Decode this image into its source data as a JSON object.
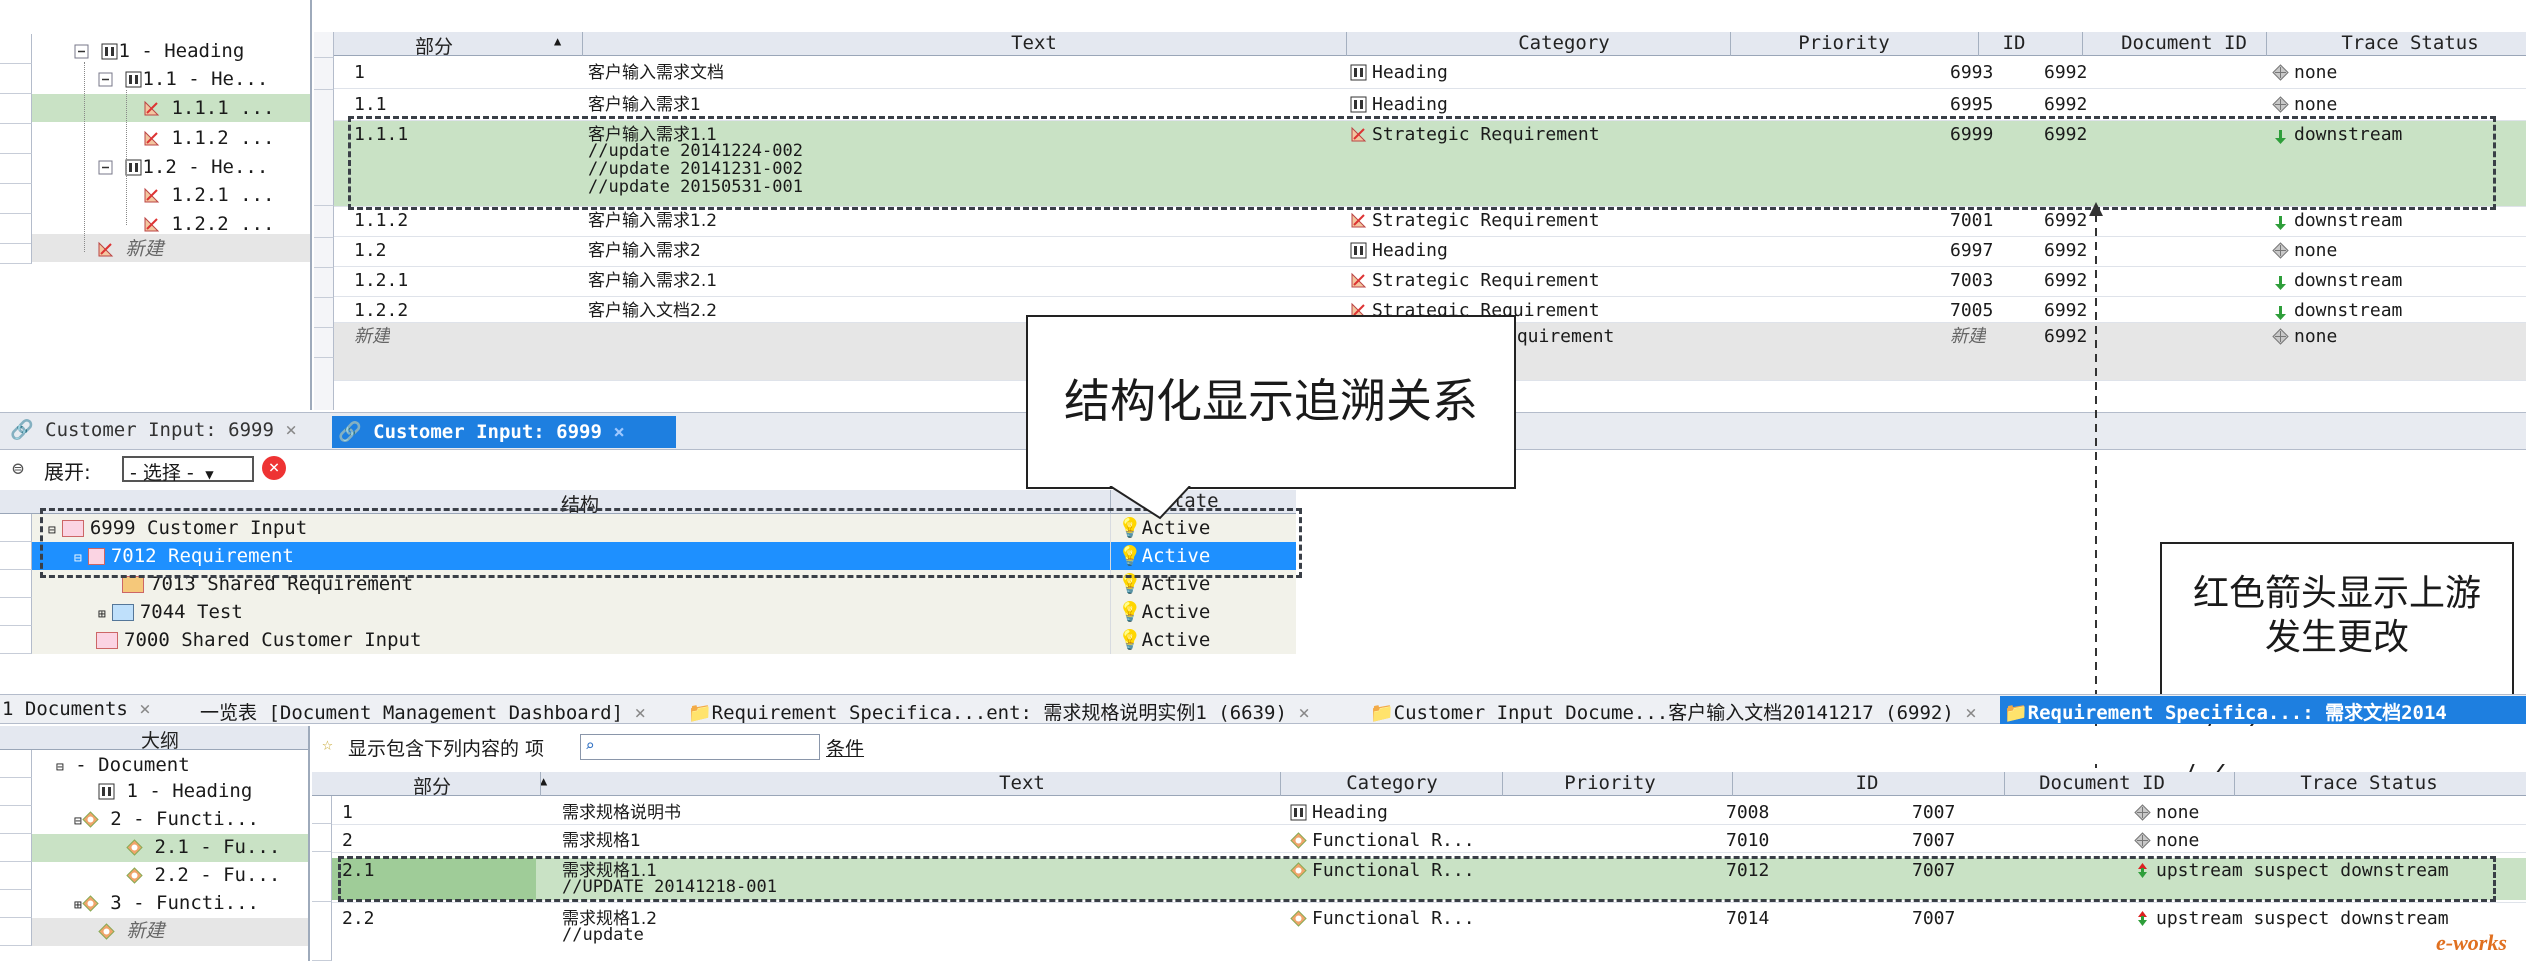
{
  "top_grid": {
    "columns": {
      "section": "部分",
      "sort_indicator": "▲",
      "text": "Text",
      "category": "Category",
      "priority": "Priority",
      "id": "ID",
      "doc_id": "Document ID",
      "trace": "Trace Status"
    },
    "rows": [
      {
        "sec": "1",
        "text": "客户输入需求文档",
        "cat": "Heading",
        "cat_icon": "heading-icon",
        "id": "6993",
        "doc": "6992",
        "trace": "none",
        "trace_icon": "none-icon"
      },
      {
        "sec": "1.1",
        "text": "客户输入需求1",
        "cat": "Heading",
        "cat_icon": "heading-icon",
        "id": "6995",
        "doc": "6992",
        "trace": "none",
        "trace_icon": "none-icon"
      },
      {
        "sec": "1.1.1",
        "text": "客户输入需求1.1",
        "text2": "//update 20141224-002",
        "text3": "//update 20141231-002",
        "text4": "//update 20150531-001",
        "cat": "Strategic Requirement",
        "cat_icon": "strategic-requirement-icon",
        "id": "6999",
        "doc": "6992",
        "trace": "downstream",
        "trace_icon": "green-down-arrow-icon"
      },
      {
        "sec": "1.1.2",
        "text": "客户输入需求1.2",
        "cat": "Strategic Requirement",
        "cat_icon": "strategic-requirement-icon",
        "id": "7001",
        "doc": "6992",
        "trace": "downstream",
        "trace_icon": "green-down-arrow-icon"
      },
      {
        "sec": "1.2",
        "text": "客户输入需求2",
        "cat": "Heading",
        "cat_icon": "heading-icon",
        "id": "6997",
        "doc": "6992",
        "trace": "none",
        "trace_icon": "none-icon"
      },
      {
        "sec": "1.2.1",
        "text": "客户输入需求2.1",
        "cat": "Strategic Requirement",
        "cat_icon": "strategic-requirement-icon",
        "id": "7003",
        "doc": "6992",
        "trace": "downstream",
        "trace_icon": "green-down-arrow-icon"
      },
      {
        "sec": "1.2.2",
        "text": "客户输入文档2.2",
        "cat": "Strategic Requirement",
        "cat_icon": "strategic-requirement-icon",
        "id": "7005",
        "doc": "6992",
        "trace": "downstream",
        "trace_icon": "green-down-arrow-icon"
      },
      {
        "sec": "新建",
        "text": "",
        "cat": "equirement",
        "cat_icon": "",
        "id": "新建",
        "doc": "6992",
        "trace": "none",
        "trace_icon": "none-icon"
      }
    ]
  },
  "top_outline": [
    "1 - Heading",
    "1.1 - He...",
    "1.1.1 ...",
    "1.1.2 ...",
    "1.2 - He...",
    "1.2.1 ...",
    "1.2.2 ...",
    "新建"
  ],
  "mid_panel": {
    "tabs": [
      "Customer Input: 6999",
      "Customer Input: 6999"
    ],
    "expand_label": "展开:",
    "expand_select": "- 选择 -",
    "columns": {
      "structure": "结构",
      "state": "State"
    },
    "rows": [
      {
        "label": "6999 Customer Input",
        "state": "Active"
      },
      {
        "label": "7012 Requirement",
        "state": "Active"
      },
      {
        "label": "7013 Shared Requirement",
        "state": "Active"
      },
      {
        "label": "7044 Test",
        "state": "Active"
      },
      {
        "label": "7000 Shared Customer Input",
        "state": "Active"
      }
    ]
  },
  "callouts": {
    "structured_trace": "结构化显示追溯关系",
    "red_arrow_line1": "红色箭头显示上游",
    "red_arrow_line2": "发生更改"
  },
  "bottom_tabs": [
    "1 Documents",
    "一览表 [Document Management Dashboard]",
    "Requirement Specifica...ent: 需求规格说明实例1 (6639)",
    "Customer Input Docume...客户输入文档20141217 (6992)",
    "Requirement Specifica...: 需求文档2014"
  ],
  "bottom_outline": {
    "title": "大纲",
    "items": [
      "- Document",
      "1 - Heading",
      "2 - Functi...",
      "2.1 - Fu...",
      "2.2 - Fu...",
      "3 - Functi...",
      "新建"
    ]
  },
  "bottom_filter": {
    "label": "显示包含下列内容的 项",
    "placeholder": "",
    "condition": "条件"
  },
  "bottom_grid": {
    "columns": {
      "section": "部分",
      "sort_indicator": "▲",
      "text": "Text",
      "category": "Category",
      "priority": "Priority",
      "id": "ID",
      "doc_id": "Document ID",
      "trace": "Trace Status"
    },
    "rows": [
      {
        "sec": "1",
        "text": "需求规格说明书",
        "cat": "Heading",
        "cat_icon": "heading-icon",
        "id": "7008",
        "doc": "7007",
        "trace": "none",
        "trace_icon": "none-icon"
      },
      {
        "sec": "2",
        "text": "需求规格1",
        "cat": "Functional R...",
        "cat_icon": "functional-requirement-icon",
        "id": "7010",
        "doc": "7007",
        "trace": "none",
        "trace_icon": "none-icon"
      },
      {
        "sec": "2.1",
        "text": "需求规格1.1",
        "text2": "//UPDATE 20141218-001",
        "cat": "Functional R...",
        "cat_icon": "functional-requirement-icon",
        "id": "7012",
        "doc": "7007",
        "trace": "upstream suspect downstream",
        "trace_icon": "red-green-arrow-icon"
      },
      {
        "sec": "2.2",
        "text": "需求规格1.2",
        "text2": "//update",
        "cat": "Functional R...",
        "cat_icon": "functional-requirement-icon",
        "id": "7014",
        "doc": "7007",
        "trace": "upstream suspect downstream",
        "trace_icon": "red-green-arrow-icon"
      }
    ]
  },
  "watermark": "e-works",
  "colors": {
    "selected_row": "#c9e2c5",
    "new_row": "#e6e6e6",
    "mid_selected": "#1e90ff",
    "header_bg": "#e4e8f0",
    "tab_active": "#1e7fe0"
  }
}
